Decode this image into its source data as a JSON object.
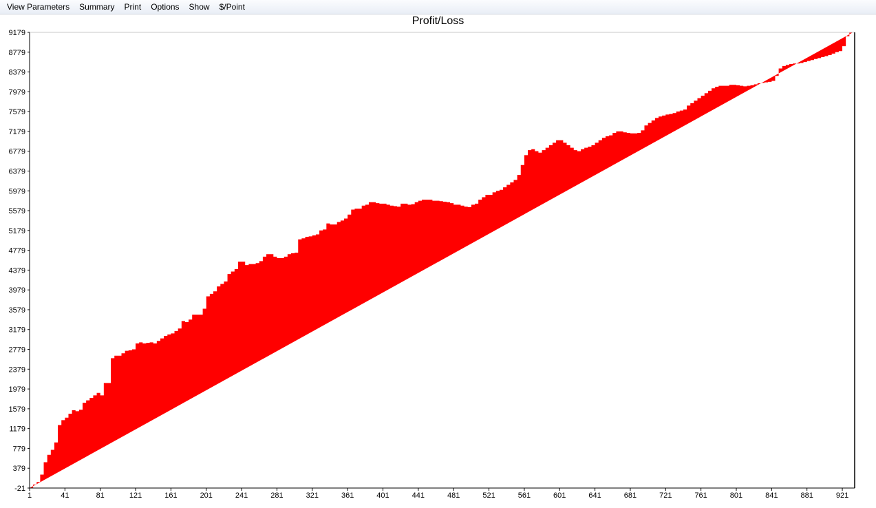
{
  "menu": {
    "items": [
      "View Parameters",
      "Summary",
      "Print",
      "Options",
      "Show",
      "$/Point"
    ]
  },
  "colors": {
    "area_fill": "#ff0000",
    "menu_bg": "#edf1f7"
  },
  "chart_data": {
    "type": "area",
    "title": "Profit/Loss",
    "xlabel": "",
    "ylabel": "",
    "xlim": [
      1,
      935
    ],
    "ylim": [
      -21,
      9179
    ],
    "y_ticks": [
      "9179",
      "8779",
      "8379",
      "7979",
      "7579",
      "7179",
      "6779",
      "6379",
      "5979",
      "5579",
      "5179",
      "4779",
      "4379",
      "3979",
      "3579",
      "3179",
      "2779",
      "2379",
      "1979",
      "1579",
      "1179",
      "779",
      "379",
      "-21"
    ],
    "x_ticks": [
      "1",
      "41",
      "81",
      "121",
      "161",
      "201",
      "241",
      "281",
      "321",
      "361",
      "401",
      "441",
      "481",
      "521",
      "561",
      "601",
      "641",
      "681",
      "721",
      "761",
      "801",
      "841",
      "881",
      "921"
    ],
    "grid": false,
    "x": [
      1,
      5,
      9,
      13,
      17,
      21,
      25,
      29,
      33,
      37,
      41,
      45,
      49,
      53,
      57,
      61,
      65,
      69,
      73,
      77,
      81,
      85,
      89,
      93,
      97,
      101,
      105,
      109,
      113,
      117,
      121,
      125,
      129,
      133,
      137,
      141,
      145,
      149,
      153,
      157,
      161,
      165,
      169,
      173,
      177,
      181,
      185,
      189,
      193,
      197,
      201,
      205,
      209,
      213,
      217,
      221,
      225,
      229,
      233,
      237,
      241,
      245,
      249,
      253,
      257,
      261,
      265,
      269,
      273,
      277,
      281,
      285,
      289,
      293,
      297,
      301,
      305,
      309,
      313,
      317,
      321,
      325,
      329,
      333,
      337,
      341,
      345,
      349,
      353,
      357,
      361,
      365,
      369,
      373,
      377,
      381,
      385,
      389,
      393,
      397,
      401,
      405,
      409,
      413,
      417,
      421,
      425,
      429,
      433,
      437,
      441,
      445,
      449,
      453,
      457,
      461,
      465,
      469,
      473,
      477,
      481,
      485,
      489,
      493,
      497,
      501,
      505,
      509,
      513,
      517,
      521,
      525,
      529,
      533,
      537,
      541,
      545,
      549,
      553,
      557,
      561,
      565,
      569,
      573,
      577,
      581,
      585,
      589,
      593,
      597,
      601,
      605,
      609,
      613,
      617,
      621,
      625,
      629,
      633,
      637,
      641,
      645,
      649,
      653,
      657,
      661,
      665,
      669,
      673,
      677,
      681,
      685,
      689,
      693,
      697,
      701,
      705,
      709,
      713,
      717,
      721,
      725,
      729,
      733,
      737,
      741,
      745,
      749,
      753,
      757,
      761,
      765,
      769,
      773,
      777,
      781,
      785,
      789,
      793,
      797,
      801,
      805,
      809,
      813,
      817,
      821,
      825,
      829,
      833,
      837,
      841,
      845,
      849,
      853,
      857,
      861,
      865,
      869,
      873,
      877,
      881,
      885,
      889,
      893,
      897,
      901,
      905,
      909,
      913,
      917,
      921,
      925,
      929,
      933,
      935
    ],
    "values": [
      -21,
      50,
      100,
      250,
      500,
      650,
      750,
      900,
      1250,
      1350,
      1400,
      1480,
      1550,
      1530,
      1560,
      1700,
      1750,
      1800,
      1850,
      1900,
      1850,
      2100,
      2100,
      2600,
      2650,
      2650,
      2700,
      2750,
      2760,
      2780,
      2900,
      2920,
      2900,
      2910,
      2920,
      2900,
      2950,
      3000,
      3050,
      3080,
      3100,
      3150,
      3200,
      3350,
      3330,
      3380,
      3480,
      3480,
      3480,
      3600,
      3850,
      3900,
      3950,
      4050,
      4100,
      4150,
      4300,
      4350,
      4400,
      4550,
      4550,
      4480,
      4500,
      4500,
      4520,
      4560,
      4650,
      4700,
      4700,
      4650,
      4620,
      4620,
      4650,
      4700,
      4720,
      4730,
      5000,
      5020,
      5050,
      5060,
      5080,
      5100,
      5180,
      5200,
      5320,
      5300,
      5300,
      5350,
      5380,
      5420,
      5500,
      5600,
      5620,
      5620,
      5680,
      5700,
      5750,
      5750,
      5730,
      5720,
      5720,
      5700,
      5680,
      5670,
      5660,
      5720,
      5720,
      5700,
      5710,
      5750,
      5780,
      5800,
      5800,
      5800,
      5780,
      5780,
      5770,
      5760,
      5750,
      5730,
      5700,
      5700,
      5680,
      5660,
      5650,
      5700,
      5720,
      5800,
      5850,
      5900,
      5900,
      5950,
      5980,
      6000,
      6050,
      6100,
      6150,
      6200,
      6300,
      6500,
      6700,
      6800,
      6820,
      6780,
      6750,
      6800,
      6850,
      6900,
      6950,
      7000,
      7000,
      6950,
      6900,
      6850,
      6800,
      6780,
      6820,
      6850,
      6870,
      6900,
      6950,
      7000,
      7050,
      7080,
      7100,
      7150,
      7180,
      7180,
      7160,
      7150,
      7140,
      7140,
      7150,
      7200,
      7300,
      7350,
      7400,
      7450,
      7480,
      7500,
      7520,
      7530,
      7550,
      7580,
      7600,
      7620,
      7700,
      7750,
      7800,
      7850,
      7900,
      7950,
      8000,
      8050,
      8080,
      8100,
      8100,
      8100,
      8120,
      8120,
      8110,
      8100,
      8090,
      8100,
      8110,
      8130,
      8150,
      8160,
      8170,
      8180,
      8200,
      8300,
      8450,
      8500,
      8520,
      8540,
      8550,
      8550,
      8560,
      8580,
      8600,
      8620,
      8640,
      8660,
      8680,
      8700,
      8720,
      8750,
      8780,
      8800,
      8900,
      9100,
      9179
    ]
  }
}
